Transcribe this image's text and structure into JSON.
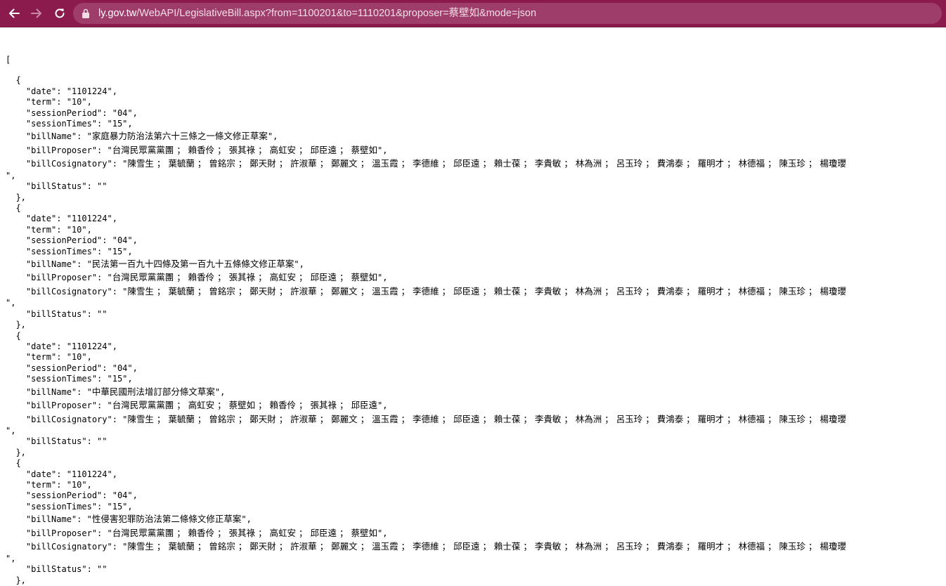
{
  "browser": {
    "url_host": "ly.gov.tw",
    "url_rest": "/WebAPI/LegislativeBill.aspx?from=1100201&to=1110201&proposer=蔡壁如&mode=json"
  },
  "json_text": {
    "open_bracket": "[",
    "records": [
      {
        "date": "1101224",
        "term": "10",
        "sessionPeriod": "04",
        "sessionTimes": "15",
        "billName": "家庭暴力防治法第六十三條之一條文修正草案",
        "billProposer": "台灣民眾黨黨團 ； 賴香伶 ； 張其祿 ； 高虹安 ； 邱臣遠 ； 蔡壁如",
        "billCosignatory": "陳雪生 ； 葉毓蘭 ； 曾銘宗 ； 鄭天財 ； 許淑華 ； 鄭麗文 ； 溫玉霞 ； 李德維 ； 邱臣遠 ； 賴士葆 ； 李貴敏 ； 林為洲 ； 呂玉玲 ； 費鴻泰 ； 羅明才 ； 林德福 ； 陳玉珍 ； 楊瓊瓔",
        "billStatus": ""
      },
      {
        "date": "1101224",
        "term": "10",
        "sessionPeriod": "04",
        "sessionTimes": "15",
        "billName": "民法第一百九十四條及第一百九十五條條文修正草案",
        "billProposer": "台灣民眾黨黨團 ； 賴香伶 ； 張其祿 ； 高虹安 ； 邱臣遠 ； 蔡壁如",
        "billCosignatory": "陳雪生 ； 葉毓蘭 ； 曾銘宗 ； 鄭天財 ； 許淑華 ； 鄭麗文 ； 溫玉霞 ； 李德維 ； 邱臣遠 ； 賴士葆 ； 李貴敏 ； 林為洲 ； 呂玉玲 ； 費鴻泰 ； 羅明才 ； 林德福 ； 陳玉珍 ； 楊瓊瓔",
        "billStatus": ""
      },
      {
        "date": "1101224",
        "term": "10",
        "sessionPeriod": "04",
        "sessionTimes": "15",
        "billName": "中華民國刑法增訂部分條文草案",
        "billProposer": "台灣民眾黨黨團 ； 高虹安 ； 蔡壁如 ； 賴香伶 ； 張其祿 ； 邱臣遠",
        "billCosignatory": "陳雪生 ； 葉毓蘭 ； 曾銘宗 ； 鄭天財 ； 許淑華 ； 鄭麗文 ； 溫玉霞 ； 李德維 ； 邱臣遠 ； 賴士葆 ； 李貴敏 ； 林為洲 ； 呂玉玲 ； 費鴻泰 ； 羅明才 ； 林德福 ； 陳玉珍 ； 楊瓊瓔",
        "billStatus": ""
      },
      {
        "date": "1101224",
        "term": "10",
        "sessionPeriod": "04",
        "sessionTimes": "15",
        "billName": "性侵害犯罪防治法第二條條文修正草案",
        "billProposer": "台灣民眾黨黨團 ； 賴香伶 ； 張其祿 ； 高虹安 ； 邱臣遠 ； 蔡壁如",
        "billCosignatory": "陳雪生 ； 葉毓蘭 ； 曾銘宗 ； 鄭天財 ； 許淑華 ； 鄭麗文 ； 溫玉霞 ； 李德維 ； 邱臣遠 ； 賴士葆 ； 李貴敏 ； 林為洲 ； 呂玉玲 ； 費鴻泰 ； 羅明才 ； 林德福 ； 陳玉珍 ； 楊瓊瓔",
        "billStatus": ""
      }
    ]
  }
}
